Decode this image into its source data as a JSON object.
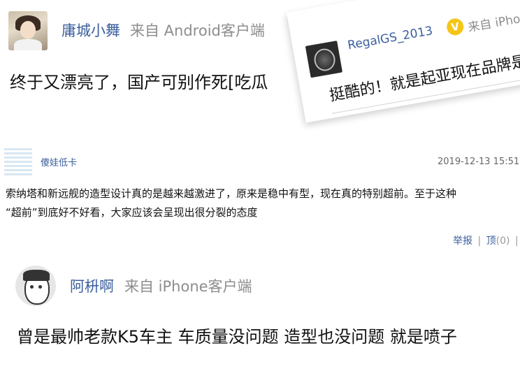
{
  "comments": [
    {
      "username": "庸城小舞",
      "source": "来自 Android客户端",
      "content": "终于又漂亮了，国产可别作死[吃瓜"
    },
    {
      "username": "RegalGS_2013",
      "badge": "V",
      "source": "来自 iPhone",
      "content": "挺酷的！就是起亚现在品牌是"
    },
    {
      "username": "傻娃低卡",
      "timestamp": "2019-12-13 15:51:",
      "content_line1": "索纳塔和新远舰的造型设计真的是越来越激进了，原来是稳中有型，现在真的特别超前。至于这种",
      "content_line2": "“超前”到底好不好看，大家应该会呈现出很分裂的态度",
      "actions": {
        "report": "举报",
        "sep": "|",
        "up": "顶",
        "up_count": "(0)",
        "reply": "回"
      }
    },
    {
      "username": "阿枡啊",
      "source": "来自 iPhone客户端",
      "content": "曾是最帅老款K5车主 车质量没问题 造型也没问题 就是喷子"
    }
  ],
  "colors": {
    "username": "#3a5e9c",
    "source": "#8d8d8d",
    "vip_badge": "#f5c518"
  }
}
